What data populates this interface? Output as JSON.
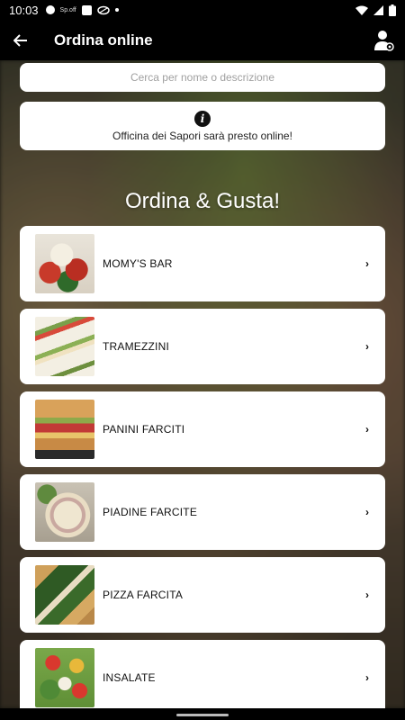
{
  "status": {
    "time": "10:03",
    "tiny_label": "Sp.off"
  },
  "app_bar": {
    "title": "Ordina online",
    "back_icon": "arrow-left-icon",
    "profile_icon": "account-settings-icon"
  },
  "search": {
    "placeholder": "Cerca per nome o descrizione"
  },
  "notice": {
    "icon": "info-icon",
    "text": "Officina dei Sapori sarà presto online!"
  },
  "heading": "Ordina & Gusta!",
  "categories": [
    {
      "label": "MOMY'S BAR",
      "chevron": "›"
    },
    {
      "label": "TRAMEZZINI",
      "chevron": "›"
    },
    {
      "label": "PANINI FARCITI",
      "chevron": "›"
    },
    {
      "label": "PIADINE FARCITE",
      "chevron": "›"
    },
    {
      "label": "PIZZA FARCITA",
      "chevron": "›"
    },
    {
      "label": "INSALATE",
      "chevron": "›"
    }
  ]
}
